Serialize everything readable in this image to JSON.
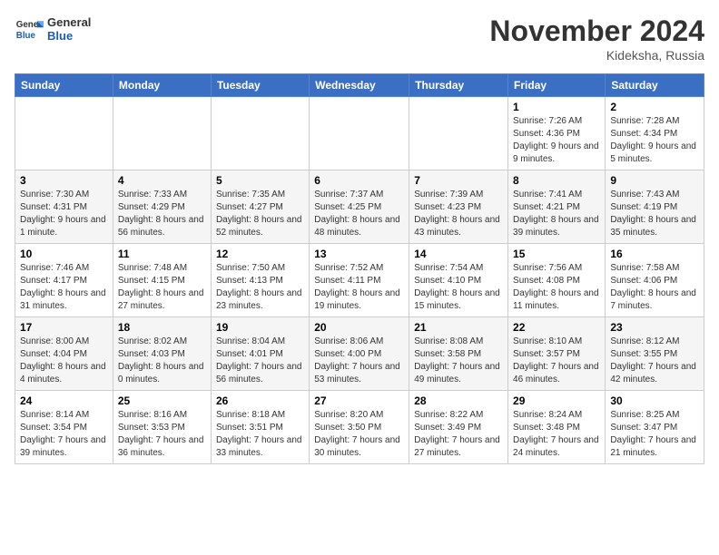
{
  "logo": {
    "line1": "General",
    "line2": "Blue"
  },
  "title": "November 2024",
  "location": "Kideksha, Russia",
  "days_header": [
    "Sunday",
    "Monday",
    "Tuesday",
    "Wednesday",
    "Thursday",
    "Friday",
    "Saturday"
  ],
  "weeks": [
    [
      {
        "day": "",
        "info": ""
      },
      {
        "day": "",
        "info": ""
      },
      {
        "day": "",
        "info": ""
      },
      {
        "day": "",
        "info": ""
      },
      {
        "day": "",
        "info": ""
      },
      {
        "day": "1",
        "info": "Sunrise: 7:26 AM\nSunset: 4:36 PM\nDaylight: 9 hours and 9 minutes."
      },
      {
        "day": "2",
        "info": "Sunrise: 7:28 AM\nSunset: 4:34 PM\nDaylight: 9 hours and 5 minutes."
      }
    ],
    [
      {
        "day": "3",
        "info": "Sunrise: 7:30 AM\nSunset: 4:31 PM\nDaylight: 9 hours and 1 minute."
      },
      {
        "day": "4",
        "info": "Sunrise: 7:33 AM\nSunset: 4:29 PM\nDaylight: 8 hours and 56 minutes."
      },
      {
        "day": "5",
        "info": "Sunrise: 7:35 AM\nSunset: 4:27 PM\nDaylight: 8 hours and 52 minutes."
      },
      {
        "day": "6",
        "info": "Sunrise: 7:37 AM\nSunset: 4:25 PM\nDaylight: 8 hours and 48 minutes."
      },
      {
        "day": "7",
        "info": "Sunrise: 7:39 AM\nSunset: 4:23 PM\nDaylight: 8 hours and 43 minutes."
      },
      {
        "day": "8",
        "info": "Sunrise: 7:41 AM\nSunset: 4:21 PM\nDaylight: 8 hours and 39 minutes."
      },
      {
        "day": "9",
        "info": "Sunrise: 7:43 AM\nSunset: 4:19 PM\nDaylight: 8 hours and 35 minutes."
      }
    ],
    [
      {
        "day": "10",
        "info": "Sunrise: 7:46 AM\nSunset: 4:17 PM\nDaylight: 8 hours and 31 minutes."
      },
      {
        "day": "11",
        "info": "Sunrise: 7:48 AM\nSunset: 4:15 PM\nDaylight: 8 hours and 27 minutes."
      },
      {
        "day": "12",
        "info": "Sunrise: 7:50 AM\nSunset: 4:13 PM\nDaylight: 8 hours and 23 minutes."
      },
      {
        "day": "13",
        "info": "Sunrise: 7:52 AM\nSunset: 4:11 PM\nDaylight: 8 hours and 19 minutes."
      },
      {
        "day": "14",
        "info": "Sunrise: 7:54 AM\nSunset: 4:10 PM\nDaylight: 8 hours and 15 minutes."
      },
      {
        "day": "15",
        "info": "Sunrise: 7:56 AM\nSunset: 4:08 PM\nDaylight: 8 hours and 11 minutes."
      },
      {
        "day": "16",
        "info": "Sunrise: 7:58 AM\nSunset: 4:06 PM\nDaylight: 8 hours and 7 minutes."
      }
    ],
    [
      {
        "day": "17",
        "info": "Sunrise: 8:00 AM\nSunset: 4:04 PM\nDaylight: 8 hours and 4 minutes."
      },
      {
        "day": "18",
        "info": "Sunrise: 8:02 AM\nSunset: 4:03 PM\nDaylight: 8 hours and 0 minutes."
      },
      {
        "day": "19",
        "info": "Sunrise: 8:04 AM\nSunset: 4:01 PM\nDaylight: 7 hours and 56 minutes."
      },
      {
        "day": "20",
        "info": "Sunrise: 8:06 AM\nSunset: 4:00 PM\nDaylight: 7 hours and 53 minutes."
      },
      {
        "day": "21",
        "info": "Sunrise: 8:08 AM\nSunset: 3:58 PM\nDaylight: 7 hours and 49 minutes."
      },
      {
        "day": "22",
        "info": "Sunrise: 8:10 AM\nSunset: 3:57 PM\nDaylight: 7 hours and 46 minutes."
      },
      {
        "day": "23",
        "info": "Sunrise: 8:12 AM\nSunset: 3:55 PM\nDaylight: 7 hours and 42 minutes."
      }
    ],
    [
      {
        "day": "24",
        "info": "Sunrise: 8:14 AM\nSunset: 3:54 PM\nDaylight: 7 hours and 39 minutes."
      },
      {
        "day": "25",
        "info": "Sunrise: 8:16 AM\nSunset: 3:53 PM\nDaylight: 7 hours and 36 minutes."
      },
      {
        "day": "26",
        "info": "Sunrise: 8:18 AM\nSunset: 3:51 PM\nDaylight: 7 hours and 33 minutes."
      },
      {
        "day": "27",
        "info": "Sunrise: 8:20 AM\nSunset: 3:50 PM\nDaylight: 7 hours and 30 minutes."
      },
      {
        "day": "28",
        "info": "Sunrise: 8:22 AM\nSunset: 3:49 PM\nDaylight: 7 hours and 27 minutes."
      },
      {
        "day": "29",
        "info": "Sunrise: 8:24 AM\nSunset: 3:48 PM\nDaylight: 7 hours and 24 minutes."
      },
      {
        "day": "30",
        "info": "Sunrise: 8:25 AM\nSunset: 3:47 PM\nDaylight: 7 hours and 21 minutes."
      }
    ]
  ]
}
